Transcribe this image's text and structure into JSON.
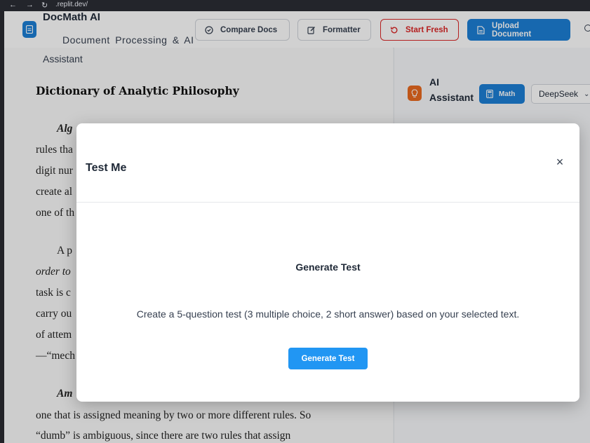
{
  "browser": {
    "url": ".replit.dev/"
  },
  "header": {
    "app_title": "DocMath AI",
    "subtitle_line1": "Document Processing & AI",
    "subtitle_line2": "Assistant",
    "buttons": {
      "compare": "Compare Docs",
      "formatter": "Formatter",
      "start_fresh": "Start Fresh",
      "upload": "Upload Document"
    }
  },
  "document": {
    "title": "Dictionary of Analytic Philosophy",
    "lines": [
      {
        "text": "Alg",
        "style": "bi"
      },
      {
        "text": "rules tha",
        "style": "normal"
      },
      {
        "text": "digit nur",
        "style": "normal"
      },
      {
        "text": "create al",
        "style": "normal"
      },
      {
        "text": "one of th",
        "style": "normal"
      },
      {
        "text": "A p",
        "style": "normal"
      },
      {
        "text": "order to",
        "style": "it"
      },
      {
        "text": "task is c",
        "style": "normal"
      },
      {
        "text": "carry ou",
        "style": "normal"
      },
      {
        "text": "of attem",
        "style": "normal"
      },
      {
        "text": "—“mech",
        "style": "normal"
      },
      {
        "text": "Am",
        "style": "bi"
      },
      {
        "text": "one that is assigned meaning by two or more different rules. So",
        "style": "normal"
      },
      {
        "text": "“dumb” is ambiguous, since there are two rules that assign",
        "style": "normal"
      }
    ]
  },
  "assistant": {
    "title": "AI Assistant",
    "math_label": "Math",
    "model": "DeepSeek"
  },
  "modal": {
    "title": "Test Me",
    "close": "×",
    "section_title": "Generate Test",
    "description": "Create a 5-question test (3 multiple choice, 2 short answer) based on your selected text.",
    "button": "Generate Test"
  },
  "colors": {
    "primary": "#1d7fd6",
    "danger": "#dc2626",
    "ai_accent": "#ea6a1f",
    "modal_button": "#2196f3"
  }
}
